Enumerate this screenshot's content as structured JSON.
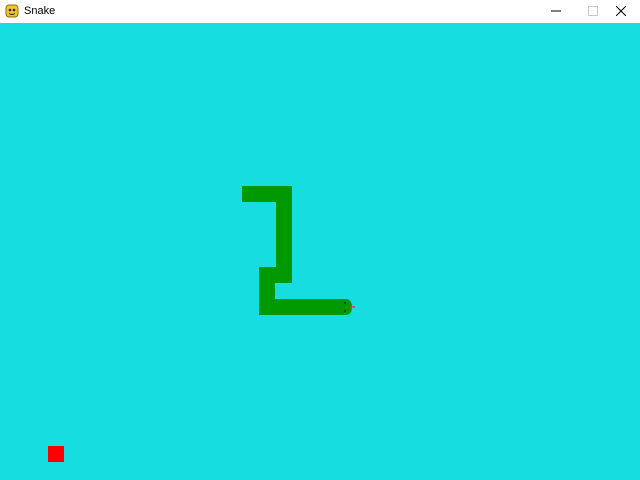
{
  "window": {
    "title": "Snake",
    "icon": "pygame-snake-icon",
    "controls": [
      "minimize",
      "maximize",
      "close"
    ]
  },
  "game": {
    "background_color": "#16dddf",
    "snake": {
      "color": "#009900",
      "head_direction": "right",
      "tongue_color": "#ff3333",
      "eye_color": "#006600"
    },
    "food": {
      "color": "#ff0000"
    }
  }
}
